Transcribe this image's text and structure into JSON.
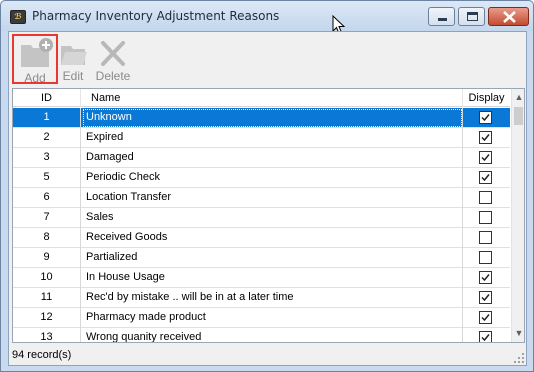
{
  "window": {
    "title": "Pharmacy Inventory Adjustment Reasons",
    "app_icon_text": "ℬ"
  },
  "toolbar": {
    "add_label": "Add",
    "edit_label": "Edit",
    "delete_label": "Delete"
  },
  "grid": {
    "columns": {
      "id": "ID",
      "name": "Name",
      "display": "Display"
    },
    "rows": [
      {
        "id": "1",
        "name": "Unknown",
        "display": true,
        "selected": true
      },
      {
        "id": "2",
        "name": "Expired",
        "display": true
      },
      {
        "id": "3",
        "name": "Damaged",
        "display": true
      },
      {
        "id": "5",
        "name": "Periodic Check",
        "display": true
      },
      {
        "id": "6",
        "name": "Location Transfer",
        "display": false
      },
      {
        "id": "7",
        "name": "Sales",
        "display": false
      },
      {
        "id": "8",
        "name": "Received Goods",
        "display": false
      },
      {
        "id": "9",
        "name": "Partialized",
        "display": false
      },
      {
        "id": "10",
        "name": "In House Usage",
        "display": true
      },
      {
        "id": "11",
        "name": "Rec'd by mistake .. will be in at a later time",
        "display": true
      },
      {
        "id": "12",
        "name": "Pharmacy made product",
        "display": true
      },
      {
        "id": "13",
        "name": "Wrong quanity received",
        "display": true
      }
    ]
  },
  "status": {
    "record_count": "94 record(s)"
  },
  "colors": {
    "selection": "#0a78d7",
    "highlight_box": "#e8382f"
  }
}
